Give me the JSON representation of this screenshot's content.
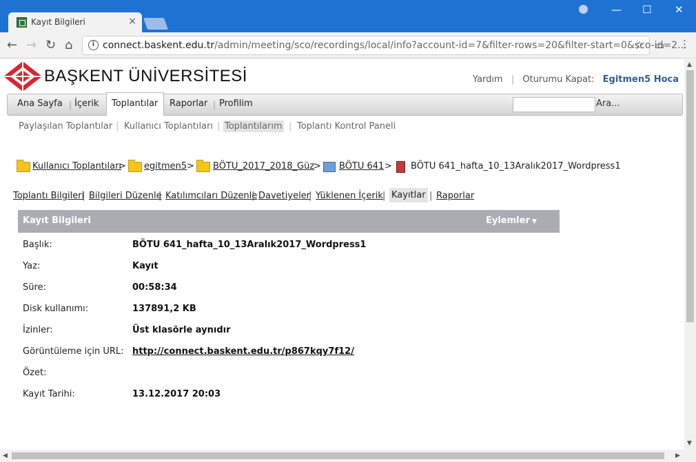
{
  "browser": {
    "tab_title": "Kayıt Bilgileri",
    "tab_close": "×",
    "url_host": "connect.baskent.edu.tr",
    "url_path": "/admin/meeting/sco/recordings/local/info?account-id=7&filter-rows=20&filter-start=0&sco-id=2...",
    "window_controls": [
      "minimize-icon",
      "maximize-icon",
      "close-icon"
    ]
  },
  "header": {
    "logo_text": "BAŞKENT  ÜNİVERSİTESİ",
    "help": "Yardım",
    "logout": "Oturumu Kapat:",
    "user": "Egitmen5 Hoca"
  },
  "mainnav": {
    "items": [
      "Ana Sayfa",
      "İçerik",
      "Toplantılar",
      "Raporlar",
      "Profilim"
    ],
    "active": "Toplantılar",
    "search_label": "Ara..."
  },
  "subnav": {
    "items": [
      "Paylaşılan Toplantılar",
      "Kullanıcı Toplantıları",
      "Toplantılarım",
      "Toplantı Kontrol Paneli"
    ],
    "current": "Toplantılarım"
  },
  "breadcrumb": {
    "items": [
      "Kullanıcı Toplantıları",
      "egitmen5",
      "BÖTU_2017_2018_Güz",
      "BÖTU 641",
      "BÖTU 641_hafta_10_13Aralık2017_Wordpress1"
    ],
    "separator": ">"
  },
  "tablinks": {
    "items": [
      "Toplantı Bilgileri",
      "Bilgileri Düzenle",
      "Katılımcıları Düzenle",
      "Davetiyeler",
      "Yüklenen İçerik",
      "Kayıtlar",
      "Raporlar"
    ],
    "current": "Kayıtlar"
  },
  "panel": {
    "title": "Kayıt Bilgileri",
    "actions": "Eylemler",
    "rows": [
      {
        "label": "Başlık:",
        "value": "BÖTU 641_hafta_10_13Aralık2017_Wordpress1"
      },
      {
        "label": "Yaz:",
        "value": "Kayıt"
      },
      {
        "label": "Süre:",
        "value": "00:58:34"
      },
      {
        "label": "Disk kullanımı:",
        "value": "137891,2 KB"
      },
      {
        "label": "İzinler:",
        "value": "Üst klasörle aynıdır"
      },
      {
        "label": "Görüntüleme için URL:",
        "value": "http://connect.baskent.edu.tr/p867kqy7f12/"
      },
      {
        "label": "Özet:",
        "value": ""
      },
      {
        "label": "Kayıt Tarihi:",
        "value": "13.12.2017 20:03"
      }
    ]
  },
  "colors": {
    "titlebar": "#1e73d2",
    "panel_header": "#a9adb2",
    "user_link": "#2e5f8f"
  }
}
